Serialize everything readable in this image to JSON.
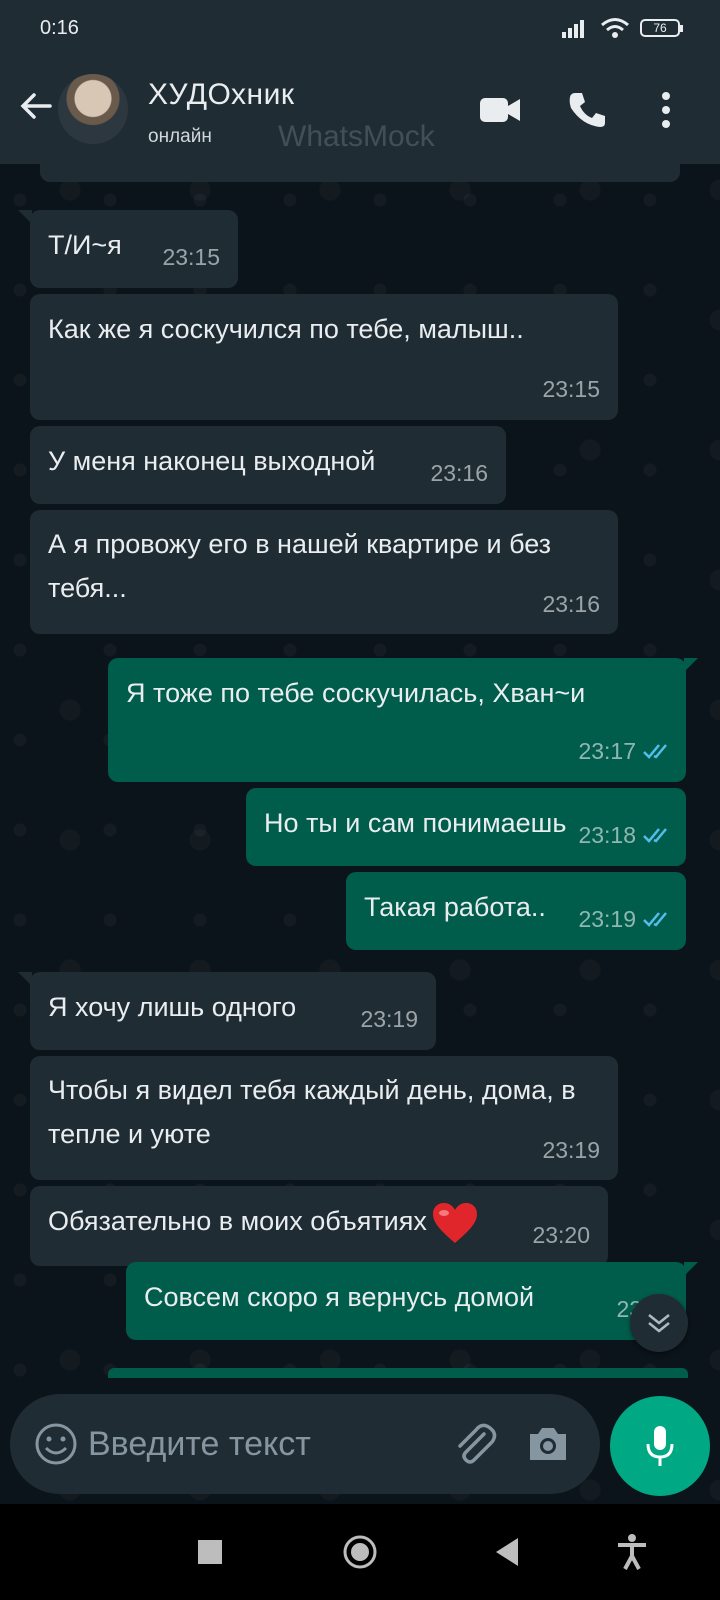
{
  "status_bar": {
    "time": "0:16",
    "battery": "76"
  },
  "header": {
    "name": "ХУДОхник",
    "status": "онлайн",
    "watermark": "WhatsMock"
  },
  "messages": [
    {
      "dir": "in",
      "text": "Т/И~я",
      "time": "23:15"
    },
    {
      "dir": "in",
      "text": "Как же я соскучился по тебе, малыш..",
      "time": "23:15"
    },
    {
      "dir": "in",
      "text": "У меня наконец выходной",
      "time": "23:16"
    },
    {
      "dir": "in",
      "text": "А я провожу его в нашей квартире и без тебя...",
      "time": "23:16"
    },
    {
      "dir": "out",
      "text": "Я тоже по тебе соскучилась, Хван~и",
      "time": "23:17"
    },
    {
      "dir": "out",
      "text": "Но ты и сам понимаешь",
      "time": "23:18"
    },
    {
      "dir": "out",
      "text": "Такая работа..",
      "time": "23:19"
    },
    {
      "dir": "in",
      "text": "Я хочу лишь одного",
      "time": "23:19"
    },
    {
      "dir": "in",
      "text": "Чтобы я видел тебя каждый день, дома, в тепле и уюте",
      "time": "23:19"
    },
    {
      "dir": "in",
      "text": "Обязательно в моих объятиях",
      "time": "23:20",
      "emoji": "red-heart"
    },
    {
      "dir": "out",
      "text": "Совсем скоро я вернусь домой",
      "time": "23:21"
    }
  ],
  "input": {
    "placeholder": "Введите текст"
  },
  "colors": {
    "background": "#0b141a",
    "header": "#1f2c34",
    "incoming": "#1f2c34",
    "outgoing": "#005c4b",
    "accent": "#00a884",
    "read_ticks": "#53bdeb"
  },
  "icons": [
    "back-arrow",
    "video-call",
    "voice-call",
    "overflow-menu",
    "emoji",
    "attach",
    "camera",
    "mic",
    "chevron-down",
    "nav-recents",
    "nav-home",
    "nav-back",
    "accessibility"
  ]
}
